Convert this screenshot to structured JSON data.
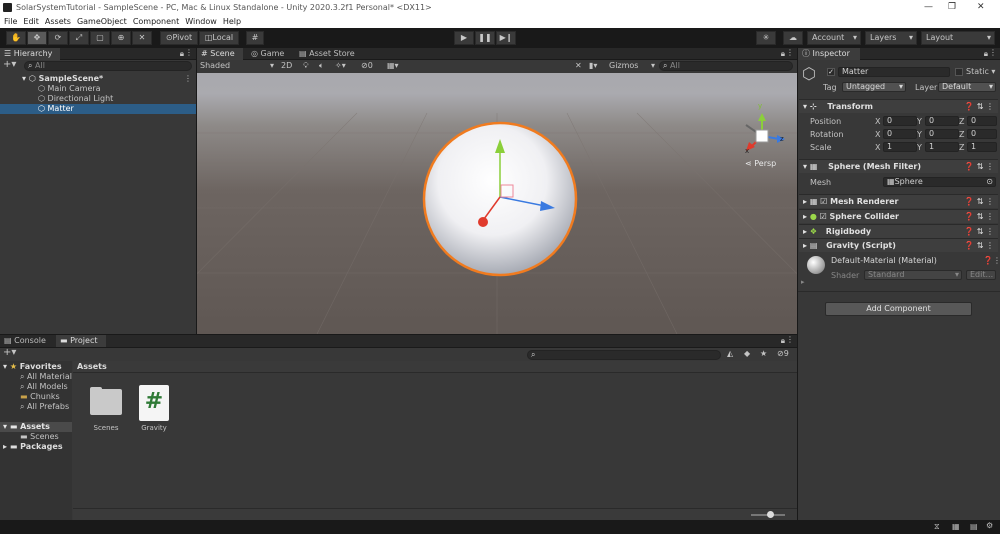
{
  "window": {
    "title": "SolarSystemTutorial - SampleScene - PC, Mac & Linux Standalone - Unity 2020.3.2f1 Personal* <DX11>",
    "minimize": "—",
    "maximize": "❐",
    "close": "✕"
  },
  "menu": [
    "File",
    "Edit",
    "Assets",
    "GameObject",
    "Component",
    "Window",
    "Help"
  ],
  "toolbar": {
    "pivot_label": "Pivot",
    "local_label": "Local",
    "account_label": "Account",
    "layers_label": "Layers",
    "layout_label": "Layout"
  },
  "hierarchy": {
    "tab": "Hierarchy",
    "search_placeholder": "All",
    "scene": "SampleScene*",
    "items": [
      "Main Camera",
      "Directional Light",
      "Matter"
    ],
    "selected": "Matter"
  },
  "scene_view": {
    "tabs": [
      "Scene",
      "Game",
      "Asset Store"
    ],
    "shading": "Shaded",
    "mode_2d": "2D",
    "hidden_count": "0",
    "gizmos": "Gizmos",
    "search_placeholder": "All",
    "persp_label": "Persp",
    "gizmo_y": "y",
    "gizmo_x": "x",
    "gizmo_z": "z"
  },
  "inspector": {
    "tab": "Inspector",
    "object_name": "Matter",
    "static_label": "Static",
    "tag_label": "Tag",
    "tag_value": "Untagged",
    "layer_label": "Layer",
    "layer_value": "Default",
    "transform": {
      "title": "Transform",
      "position_label": "Position",
      "rotation_label": "Rotation",
      "scale_label": "Scale",
      "axis_x": "X",
      "axis_y": "Y",
      "axis_z": "Z",
      "position": [
        "0",
        "0",
        "0"
      ],
      "rotation": [
        "0",
        "0",
        "0"
      ],
      "scale": [
        "1",
        "1",
        "1"
      ]
    },
    "mesh_filter": {
      "title": "Sphere (Mesh Filter)",
      "mesh_label": "Mesh",
      "mesh_value": "Sphere"
    },
    "components": [
      "Mesh Renderer",
      "Sphere Collider",
      "Rigidbody",
      "Gravity (Script)"
    ],
    "material": {
      "name": "Default-Material (Material)",
      "shader_label": "Shader",
      "shader_value": "Standard",
      "edit_label": "Edit..."
    },
    "add_component_label": "Add Component"
  },
  "project": {
    "tabs": [
      "Console",
      "Project"
    ],
    "hidden_count": "9",
    "favorites_label": "Favorites",
    "favorites": [
      "All Material",
      "All Models",
      "Chunks",
      "All Prefabs"
    ],
    "assets_label": "Assets",
    "assets_children": [
      "Scenes"
    ],
    "packages_label": "Packages",
    "breadcrumb": "Assets",
    "files": [
      {
        "name": "Scenes",
        "type": "folder"
      },
      {
        "name": "Gravity",
        "type": "script"
      }
    ]
  },
  "colors": {
    "selection": "#2c5d87",
    "accent_orange": "#f07b1f",
    "gizmo_red": "#e03a2c",
    "gizmo_green": "#8bcf3a",
    "gizmo_blue": "#3a7ae0"
  }
}
